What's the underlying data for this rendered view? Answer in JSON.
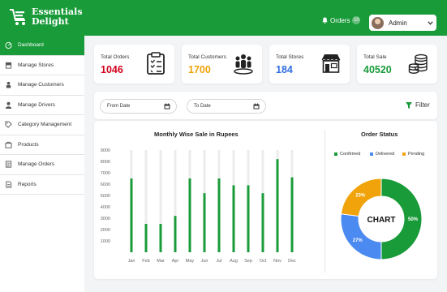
{
  "brand": {
    "line1": "Essentials",
    "line2": "Delight"
  },
  "header": {
    "orders_label": "Orders",
    "orders_count": "10",
    "admin_label": "Admin"
  },
  "sidebar": {
    "items": [
      {
        "label": "Dashboard",
        "icon": "dashboard-icon"
      },
      {
        "label": "Manage Stores",
        "icon": "store-icon"
      },
      {
        "label": "Manage Customers",
        "icon": "customers-icon"
      },
      {
        "label": "Manage Drivers",
        "icon": "driver-icon"
      },
      {
        "label": "Category Management",
        "icon": "category-icon"
      },
      {
        "label": "Products",
        "icon": "products-icon"
      },
      {
        "label": "Manage Orders",
        "icon": "orders-icon"
      },
      {
        "label": "Reports",
        "icon": "reports-icon"
      }
    ]
  },
  "stats": [
    {
      "label": "Total Orders",
      "value": "1046",
      "color": "#d0021b",
      "icon": "clipboard-icon"
    },
    {
      "label": "Total Customers",
      "value": "1700",
      "color": "#f0a30a",
      "icon": "people-icon"
    },
    {
      "label": "Total Stores",
      "value": "184",
      "color": "#2f6fe0",
      "icon": "storefront-icon"
    },
    {
      "label": "Total Sale",
      "value": "40520",
      "color": "#1a9b3a",
      "icon": "coins-icon"
    }
  ],
  "filters": {
    "from_label": "From Date",
    "to_label": "To Date",
    "filter_label": "Filter"
  },
  "bar_chart_title": "Monthly Wise Sale in Rupees",
  "donut_title": "Order Status",
  "donut_center": "CHART",
  "colors": {
    "brand_green": "#1a9b3a",
    "confirmed": "#1a9b3a",
    "delivered": "#4b8af0",
    "pending": "#f0a30a"
  },
  "chart_data": [
    {
      "type": "bar",
      "title": "Monthly Wise Sale in Rupees",
      "categories": [
        "Jan",
        "Feb",
        "Mar",
        "Apr",
        "May",
        "Jun",
        "Jul",
        "Aug",
        "Sep",
        "Oct",
        "Nov",
        "Dec"
      ],
      "values": [
        6500,
        2500,
        2500,
        3200,
        6500,
        5200,
        6500,
        5900,
        5900,
        5200,
        8200,
        6600
      ],
      "ylim": [
        0,
        9000
      ],
      "yticks": [
        1000,
        2000,
        3000,
        4000,
        5000,
        6000,
        7000,
        8000,
        9000
      ],
      "grid": false
    },
    {
      "type": "pie",
      "title": "Order Status",
      "legend_position": "top",
      "labels": [
        "Confirmed",
        "Delivered",
        "Pending"
      ],
      "values": [
        50,
        27,
        23
      ],
      "value_labels": [
        "50%",
        "27%",
        "23%"
      ]
    }
  ]
}
